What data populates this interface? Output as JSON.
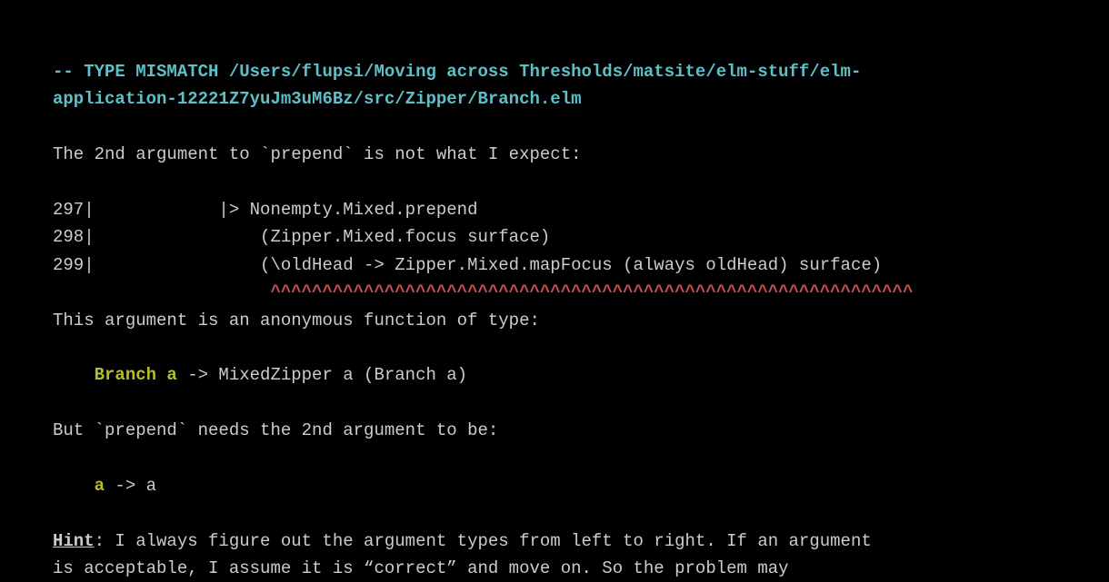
{
  "header": {
    "line1": "-- TYPE MISMATCH  /Users/flupsi/Moving across Thresholds/matsite/elm-stuff/elm-",
    "line2": "application-12221Z7yuJm3uM6Bz/src/Zipper/Branch.elm"
  },
  "intro": "The 2nd argument to `prepend` is not what I expect:",
  "code": {
    "l297": "297|            |> Nonempty.Mixed.prepend",
    "l298": "298|                (Zipper.Mixed.focus surface)",
    "l299": "299|                (\\oldHead -> Zipper.Mixed.mapFocus (always oldHead) surface)",
    "carets": "                     ^^^^^^^^^^^^^^^^^^^^^^^^^^^^^^^^^^^^^^^^^^^^^^^^^^^^^^^^^^^^^^"
  },
  "explain1": "This argument is an anonymous function of type:",
  "type1": {
    "indent": "    ",
    "highlighted": "Branch a",
    "rest": " -> MixedZipper a (Branch a)"
  },
  "explain2": "But `prepend` needs the 2nd argument to be:",
  "type2": {
    "indent": "    ",
    "highlighted": "a",
    "rest": " -> a"
  },
  "hint": {
    "label": "Hint",
    "line1": ": I always figure out the argument types from left to right. If an argument",
    "line2": "is acceptable, I assume it is “correct” and move on. So the problem may"
  }
}
